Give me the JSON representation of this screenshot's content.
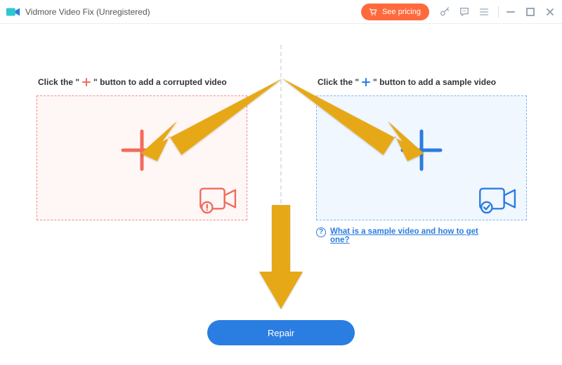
{
  "titlebar": {
    "app_name": "Vidmore Video Fix (Unregistered)",
    "pricing_label": "See pricing"
  },
  "left": {
    "label_pre": "Click the \"",
    "label_post": "\" button to add a corrupted video"
  },
  "right": {
    "label_pre": "Click the \"",
    "label_post": "\" button to add a sample video",
    "help_text": "What is a sample video and how to get one?"
  },
  "repair_label": "Repair",
  "colors": {
    "accent_blue": "#2a7de1",
    "accent_orange": "#ff6a3d",
    "coral": "#f26b5b",
    "arrow": "#e6a817"
  }
}
